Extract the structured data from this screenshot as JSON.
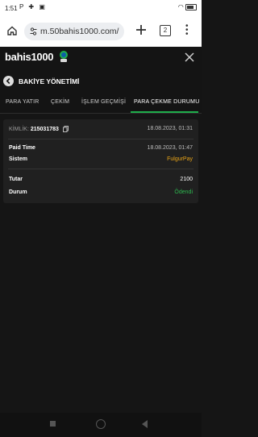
{
  "status_bar": {
    "time": "1:51",
    "left_icons": "P ✚ ▣",
    "battery": ""
  },
  "browser": {
    "url": "m.50bahis1000.com/",
    "tab_count": "2"
  },
  "site": {
    "logo_text": "bahis1000"
  },
  "page": {
    "title": "BAKİYE YÖNETİMİ"
  },
  "tabs": [
    {
      "label": "PARA YATIR"
    },
    {
      "label": "ÇEKİM"
    },
    {
      "label": "İŞLEM GEÇMİŞİ"
    },
    {
      "label": "PARA ÇEKME DURUMU"
    }
  ],
  "active_tab": 3,
  "transaction": {
    "id_label": "KİMLİK:",
    "id_value": "215031783",
    "created": "18.08.2023, 01:31",
    "paid_time_label": "Paid Time",
    "paid_time_value": "18.08.2023, 01:47",
    "system_label": "Sistem",
    "system_value": "FulgurPay",
    "amount_label": "Tutar",
    "amount_value": "2100",
    "status_label": "Durum",
    "status_value": "Ödendi"
  },
  "colors": {
    "accent_green": "#1fae4b",
    "status_paid": "#2eb84f",
    "system_orange": "#e7a317",
    "background": "#151515",
    "card": "#202020"
  }
}
